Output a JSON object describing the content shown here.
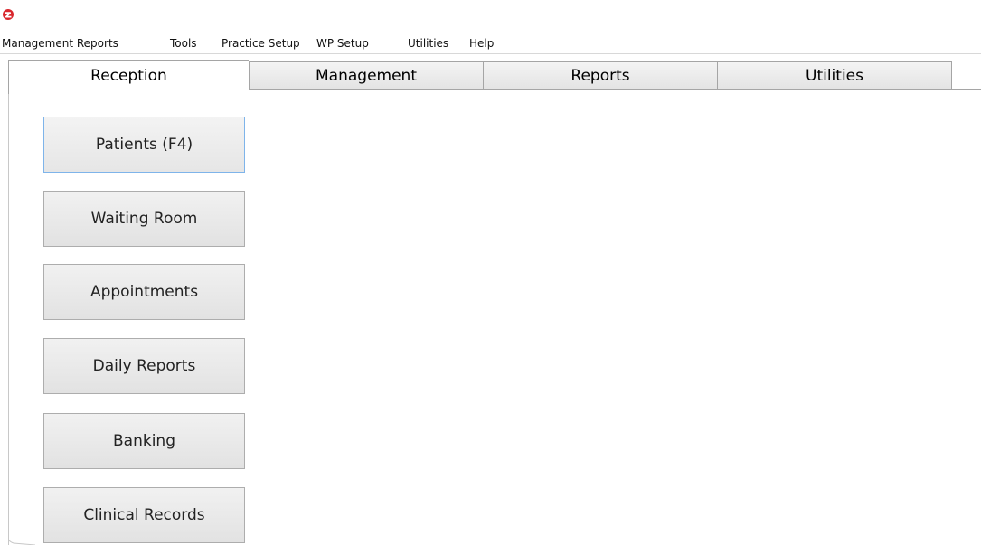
{
  "app": {
    "logo_icon": "app-logo-icon",
    "logo_color": "#d9262c"
  },
  "menubar": {
    "items": [
      {
        "label": "Management Reports"
      },
      {
        "label": "Tools"
      },
      {
        "label": "Practice Setup"
      },
      {
        "label": "WP Setup"
      },
      {
        "label": "Utilities"
      },
      {
        "label": "Help"
      }
    ]
  },
  "tabs": [
    {
      "label": "Reception",
      "active": true
    },
    {
      "label": "Management",
      "active": false
    },
    {
      "label": "Reports",
      "active": false
    },
    {
      "label": "Utilities",
      "active": false
    }
  ],
  "reception": {
    "buttons": [
      {
        "label": "Patients (F4)",
        "focused": true
      },
      {
        "label": "Waiting Room",
        "focused": false
      },
      {
        "label": "Appointments",
        "focused": false
      },
      {
        "label": "Daily Reports",
        "focused": false
      },
      {
        "label": "Banking",
        "focused": false
      },
      {
        "label": "Clinical Records",
        "focused": false
      }
    ]
  },
  "colors": {
    "focus_border": "#7eb4ea",
    "button_border": "#adadad",
    "tab_border": "#a5a5a5"
  }
}
